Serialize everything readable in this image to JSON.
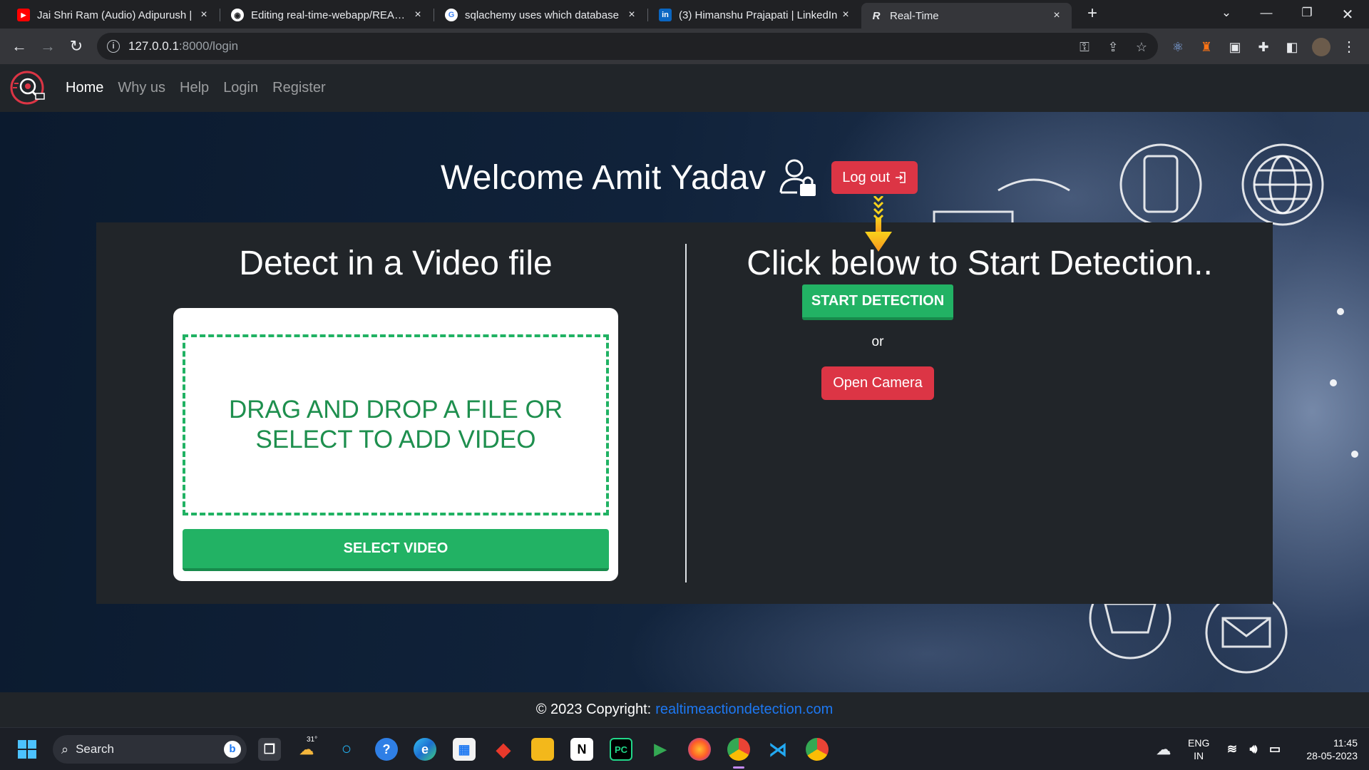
{
  "browser": {
    "tabs": [
      {
        "title": "Jai Shri Ram (Audio) Adipurush | ",
        "favicon": "youtube-icon",
        "close": "×"
      },
      {
        "title": "Editing real-time-webapp/README",
        "favicon": "github-icon",
        "close": "×"
      },
      {
        "title": "sqlachemy uses which database",
        "favicon": "google-icon",
        "close": "×"
      },
      {
        "title": "(3) Himanshu Prajapati | LinkedIn",
        "favicon": "linkedin-icon",
        "close": "×"
      },
      {
        "title": "Real-Time",
        "favicon": "page-icon",
        "close": "×"
      }
    ],
    "new_tab": "+",
    "url_host": "127.0.0.1",
    "url_path": ":8000/login"
  },
  "site": {
    "nav": [
      "Home",
      "Why us",
      "Help",
      "Login",
      "Register"
    ],
    "welcome": "Welcome Amit Yadav",
    "logout_label": "Log out",
    "left_title": "Detect in a Video file",
    "dropzone_text": "DRAG AND DROP A FILE OR SELECT TO ADD VIDEO",
    "select_video_label": "SELECT VIDEO",
    "right_title": "Click below to Start Detection..",
    "start_detection_label": "START DETECTION",
    "or_text": "or",
    "open_camera_label": "Open Camera",
    "footer_prefix": "© 2023 Copyright:",
    "footer_link": "realtimeactiondetection.com"
  },
  "taskbar": {
    "search_label": "Search",
    "weather": "31°",
    "lang_top": "ENG",
    "lang_bottom": "IN",
    "time": "11:45",
    "date": "28-05-2023"
  },
  "colors": {
    "success": "#22b264",
    "danger": "#dc3545",
    "link": "#1d78f2",
    "navbar": "#212529"
  }
}
